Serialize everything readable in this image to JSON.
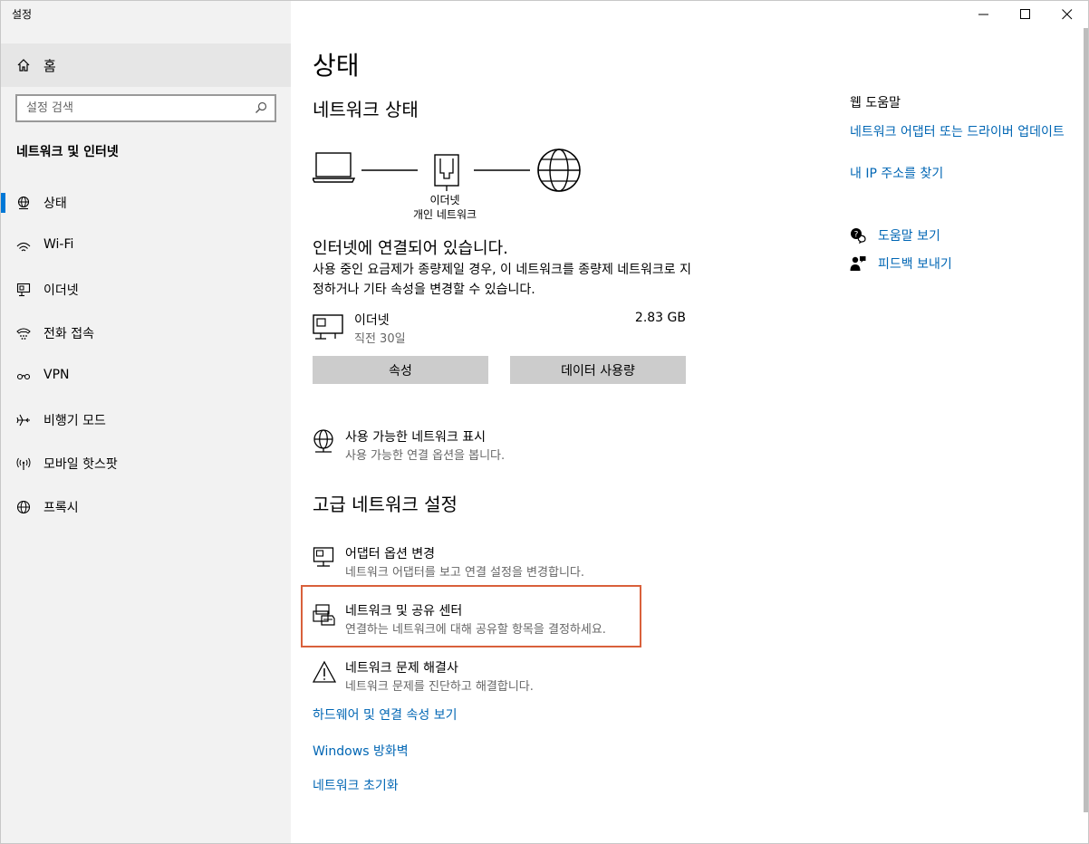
{
  "window": {
    "title": "설정"
  },
  "sidebar": {
    "home_label": "홈",
    "search_placeholder": "설정 검색",
    "section_title": "네트워크 및 인터넷",
    "items": [
      {
        "label": "상태",
        "icon": "globe-network-icon",
        "active": true
      },
      {
        "label": "Wi-Fi",
        "icon": "wifi-icon"
      },
      {
        "label": "이더넷",
        "icon": "ethernet-icon"
      },
      {
        "label": "전화 접속",
        "icon": "dialup-icon"
      },
      {
        "label": "VPN",
        "icon": "vpn-icon"
      },
      {
        "label": "비행기 모드",
        "icon": "airplane-icon"
      },
      {
        "label": "모바일 핫스팟",
        "icon": "hotspot-icon"
      },
      {
        "label": "프록시",
        "icon": "proxy-globe-icon"
      }
    ]
  },
  "main": {
    "title": "상태",
    "network_status_heading": "네트워크 상태",
    "diagram": {
      "line1": "이더넷",
      "line2": "개인 네트워크"
    },
    "connected_title": "인터넷에 연결되어 있습니다.",
    "connected_desc": "사용 중인 요금제가 종량제일 경우, 이 네트워크를 종량제 네트워크로 지정하거나 기타 속성을 변경할 수 있습니다.",
    "ethernet": {
      "name": "이더넷",
      "sub": "직전 30일",
      "size": "2.83 GB"
    },
    "buttons": {
      "properties": "속성",
      "data_usage": "데이터 사용량"
    },
    "show_networks": {
      "title": "사용 가능한 네트워크 표시",
      "sub": "사용 가능한 연결 옵션을 봅니다."
    },
    "advanced_heading": "고급 네트워크 설정",
    "adapter": {
      "title": "어댑터 옵션 변경",
      "sub": "네트워크 어댑터를 보고 연결 설정을 변경합니다."
    },
    "sharing_center": {
      "title": "네트워크 및 공유 센터",
      "sub": "연결하는 네트워크에 대해 공유할 항목을 결정하세요."
    },
    "troubleshooter": {
      "title": "네트워크 문제 해결사",
      "sub": "네트워크 문제를 진단하고 해결합니다."
    },
    "links": {
      "hardware": "하드웨어 및 연결 속성 보기",
      "firewall": "Windows 방화벽",
      "reset": "네트워크 초기화"
    }
  },
  "right": {
    "web_help_title": "웹 도움말",
    "link_adapter_driver": "네트워크 어댑터 또는 드라이버 업데이트",
    "link_find_ip": "내 IP 주소를 찾기",
    "help_label": "도움말 보기",
    "feedback_label": "피드백 보내기"
  },
  "colors": {
    "accent": "#0078d7",
    "link": "#0066b4",
    "highlight": "#d9603b"
  }
}
